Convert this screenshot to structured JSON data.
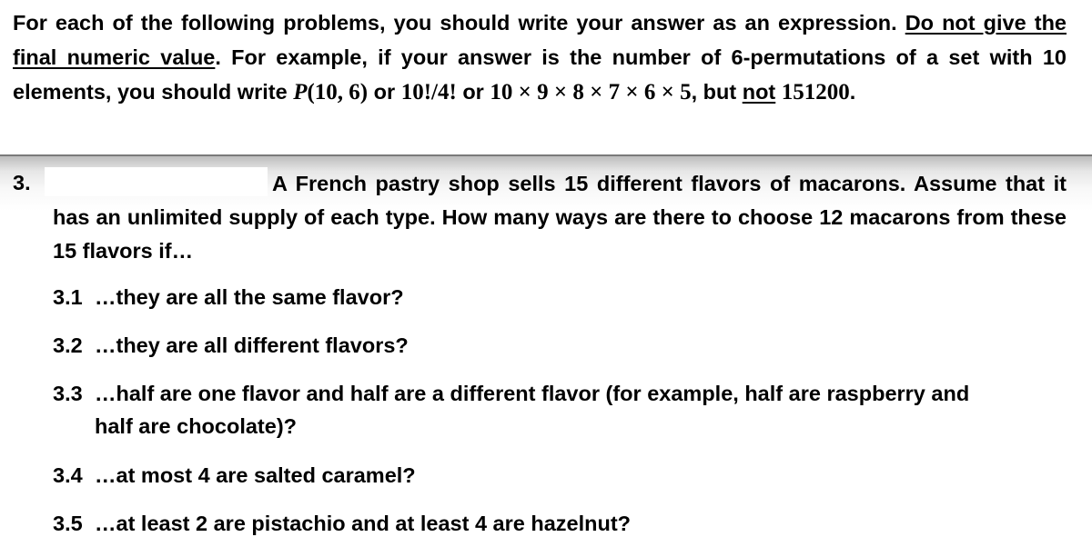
{
  "instructions": {
    "part1": "For each of the following problems, you should write your answer as an expression. ",
    "do_not": "Do not give the final numeric value",
    "part2": ". For example, if your answer is the number of 6-permutations of a set with 10 elements, you should write ",
    "expr_p_func": "P",
    "expr_p_args": "(10, 6)",
    "or1": " or ",
    "expr_fact": "10!/4!",
    "or2": " or ",
    "expr_product": "10 × 9 × 8 × 7 × 6 × 5",
    "part3": ", but ",
    "not_word": "not",
    "space": " ",
    "expr_value": "151200",
    "period": "."
  },
  "problem": {
    "number": "3.",
    "text": "A French pastry shop sells 15 different flavors of macarons. Assume that it has an unlimited supply of each type. How many ways are there to choose 12 macarons from these 15 flavors if…",
    "subquestions": [
      {
        "label": "3.1",
        "text": "…they are all the same flavor?"
      },
      {
        "label": "3.2",
        "text": "…they are all different flavors?"
      },
      {
        "label": "3.3",
        "text": "…half are one flavor and half are a different flavor (for example, half are raspberry and",
        "continuation": "half are chocolate)?"
      },
      {
        "label": "3.4",
        "text": "…at most 4 are salted caramel?"
      },
      {
        "label": "3.5",
        "text": "…at least 2 are pistachio and at least 4 are hazelnut?"
      }
    ]
  }
}
